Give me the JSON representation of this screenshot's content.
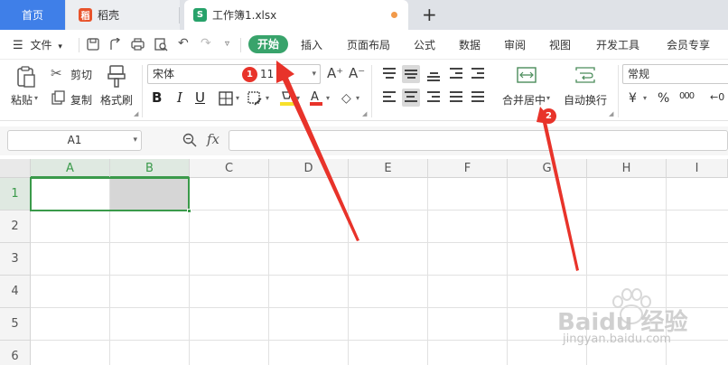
{
  "tabs": {
    "home": "首页",
    "doc": "稻壳",
    "active": "工作簿1.xlsx",
    "doc_icon": "稻",
    "active_icon": "S"
  },
  "menu": {
    "file": "文件",
    "items": [
      "开始",
      "插入",
      "页面布局",
      "公式",
      "数据",
      "审阅",
      "视图",
      "开发工具",
      "会员专享"
    ]
  },
  "ribbon": {
    "paste": "粘贴",
    "cut": "剪切",
    "copy": "复制",
    "format_painter": "格式刷",
    "font_name": "宋体",
    "font_size": "11",
    "merge_center": "合并居中",
    "wrap_text": "自动换行",
    "number_format": "常规",
    "currency": "¥",
    "percent": "%",
    "thousands": "000"
  },
  "formula_bar": {
    "name_box": "A1",
    "fx": "fx",
    "value": ""
  },
  "sheet": {
    "columns": [
      "A",
      "B",
      "C",
      "D",
      "E",
      "F",
      "G",
      "H",
      "I"
    ],
    "rows": [
      "1",
      "2",
      "3",
      "4",
      "5",
      "6"
    ],
    "selected_range": "A1:B1"
  },
  "annotations": {
    "badge1": "1",
    "badge2": "2",
    "color": "#e8332a"
  },
  "watermark": {
    "line1": "Baidu 经验",
    "line2": "jingyan.baidu.com"
  },
  "colors": {
    "accent_green": "#38a36b",
    "home_tab": "#3f7fe8"
  }
}
